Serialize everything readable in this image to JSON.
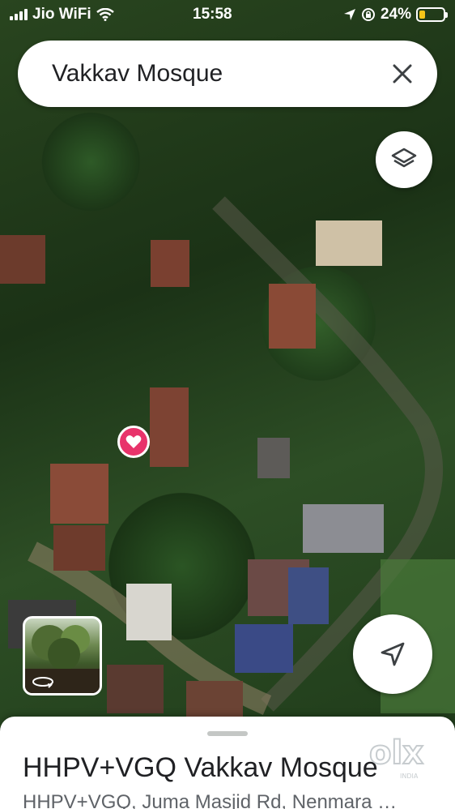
{
  "status_bar": {
    "carrier": "Jio WiFi",
    "time": "15:58",
    "battery_percent": "24%",
    "battery_level": 0.24,
    "battery_color": "#f5c518"
  },
  "search": {
    "query": "Vakkav Mosque",
    "close_icon": "close-icon"
  },
  "map": {
    "layers_icon": "layers-icon",
    "locate_icon": "navigation-arrow-icon",
    "marker_icon": "heart-icon",
    "marker_color": "#e8336b",
    "street_view_icon": "rotate-360-icon"
  },
  "place": {
    "title": "HHPV+VGQ Vakkav Mosque",
    "subtitle": "HHPV+VGQ, Juma Masjid Rd, Nenmara"
  },
  "watermark": {
    "text": "olx",
    "subtext": "INDIA"
  }
}
